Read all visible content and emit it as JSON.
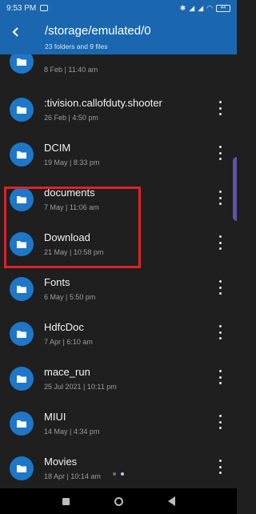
{
  "status_bar": {
    "time": "9:53 PM",
    "battery": "44"
  },
  "header": {
    "path": "/storage/emulated/0",
    "subtitle": "23 folders and 9 files"
  },
  "rows": [
    {
      "name": "",
      "date": "8 Feb | 11:40 am"
    },
    {
      "name": ":tivision.callofduty.shooter",
      "date": "26 Feb | 4:50 pm"
    },
    {
      "name": "DCIM",
      "date": "19 May | 8:33 pm"
    },
    {
      "name": "documents",
      "date": "7 May | 11:06 am"
    },
    {
      "name": "Download",
      "date": "21 May | 10:58 pm"
    },
    {
      "name": "Fonts",
      "date": "6 May | 5:50 pm"
    },
    {
      "name": "HdfcDoc",
      "date": "7 Apr | 6:10 am"
    },
    {
      "name": "mace_run",
      "date": "25 Jul 2021 | 10:11 pm"
    },
    {
      "name": "MIUI",
      "date": "14 May | 4:34 pm"
    },
    {
      "name": "Movies",
      "date": "18 Apr | 10:14 am"
    }
  ],
  "colors": {
    "accent": "#1a67b0",
    "folder": "#1e77c8",
    "highlight": "#e0202a"
  }
}
